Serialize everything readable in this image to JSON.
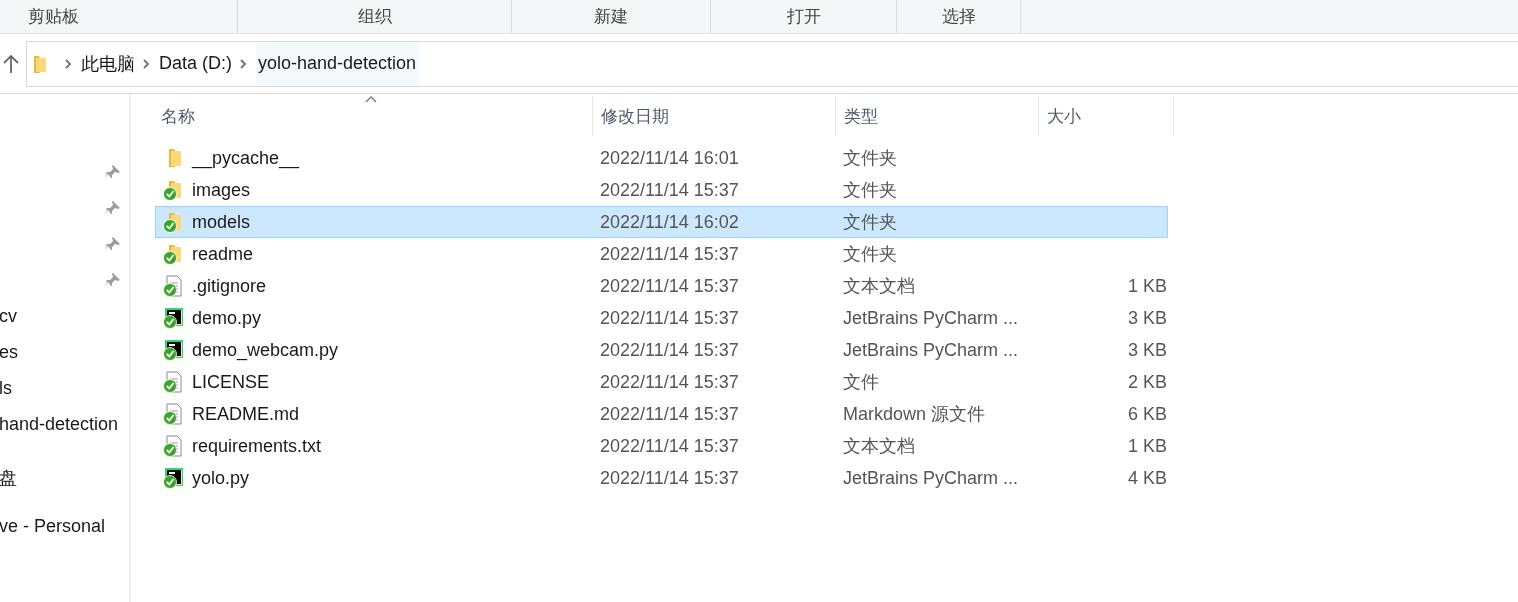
{
  "ribbon_groups": [
    "剪贴板",
    "组织",
    "新建",
    "打开",
    "选择"
  ],
  "breadcrumb": [
    "此电脑",
    "Data (D:)",
    "yolo-hand-detection"
  ],
  "sidebar": {
    "items": [
      {
        "pinned": true
      },
      {
        "pinned": true
      },
      {
        "pinned": true
      },
      {
        "pinned": true
      },
      {
        "label": "cv",
        "pinned": false
      },
      {
        "label": "es",
        "pinned": false
      },
      {
        "label": "ls",
        "pinned": false
      },
      {
        "label": "hand-detection",
        "pinned": false
      },
      {
        "label": "盘",
        "pinned": false
      },
      {
        "label": "ve - Personal",
        "pinned": false
      }
    ]
  },
  "table": {
    "columns": [
      "名称",
      "修改日期",
      "类型",
      "大小"
    ],
    "rows": [
      {
        "name": "__pycache__",
        "modified": "2022/11/14 16:01",
        "type": "文件夹",
        "kind": "folder",
        "synced": false,
        "selected": false
      },
      {
        "name": "images",
        "modified": "2022/11/14 15:37",
        "type": "文件夹",
        "kind": "folder",
        "synced": true,
        "selected": false
      },
      {
        "name": "models",
        "modified": "2022/11/14 16:02",
        "type": "文件夹",
        "kind": "folder",
        "synced": true,
        "selected": true
      },
      {
        "name": "readme",
        "modified": "2022/11/14 15:37",
        "type": "文件夹",
        "kind": "folder",
        "synced": true,
        "selected": false
      },
      {
        "name": ".gitignore",
        "modified": "2022/11/14 15:37",
        "type": "文本文档",
        "size": "1 KB",
        "kind": "text",
        "synced": true,
        "selected": false
      },
      {
        "name": "demo.py",
        "modified": "2022/11/14 15:37",
        "type": "JetBrains PyCharm ...",
        "size": "3 KB",
        "kind": "pycharm",
        "synced": true,
        "selected": false
      },
      {
        "name": "demo_webcam.py",
        "modified": "2022/11/14 15:37",
        "type": "JetBrains PyCharm ...",
        "size": "3 KB",
        "kind": "pycharm",
        "synced": true,
        "selected": false
      },
      {
        "name": "LICENSE",
        "modified": "2022/11/14 15:37",
        "type": "文件",
        "size": "2 KB",
        "kind": "text",
        "synced": true,
        "selected": false
      },
      {
        "name": "README.md",
        "modified": "2022/11/14 15:37",
        "type": "Markdown 源文件",
        "size": "6 KB",
        "kind": "text",
        "synced": true,
        "selected": false
      },
      {
        "name": "requirements.txt",
        "modified": "2022/11/14 15:37",
        "type": "文本文档",
        "size": "1 KB",
        "kind": "text",
        "synced": true,
        "selected": false
      },
      {
        "name": "yolo.py",
        "modified": "2022/11/14 15:37",
        "type": "JetBrains PyCharm ...",
        "size": "4 KB",
        "kind": "pycharm",
        "synced": true,
        "selected": false
      }
    ]
  }
}
